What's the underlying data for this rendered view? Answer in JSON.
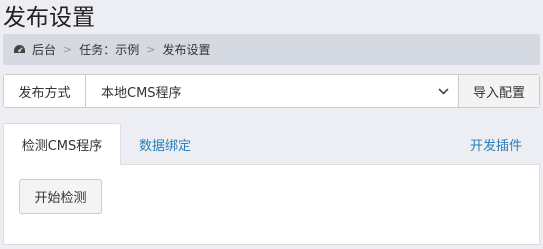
{
  "page": {
    "title": "发布设置"
  },
  "breadcrumb": {
    "items": [
      "后台",
      "任务：示例",
      "发布设置"
    ],
    "separator": ">"
  },
  "publish": {
    "label": "发布方式",
    "selected": "本地CMS程序",
    "import_button": "导入配置"
  },
  "tabs": [
    {
      "label": "检测CMS程序",
      "active": true
    },
    {
      "label": "数据绑定",
      "active": false
    },
    {
      "label": "开发插件",
      "active": false
    }
  ],
  "panel": {
    "detect_button": "开始检测"
  },
  "colors": {
    "link": "#2a7fb8",
    "background": "#eceef4",
    "breadcrumb_bg": "#d5d9e1"
  }
}
